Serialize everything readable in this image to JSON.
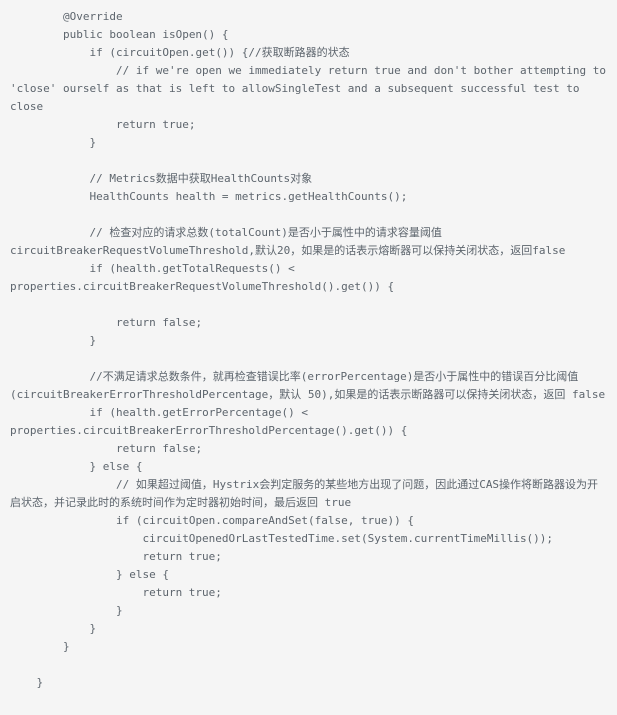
{
  "page": {
    "kind": "code-snippet",
    "language": "java",
    "background_color": "#f5f5f5",
    "text_color": "#5d656d"
  },
  "code": {
    "lines": [
      "        @Override",
      "        public boolean isOpen() {",
      "            if (circuitOpen.get()) {//获取断路器的状态",
      "                // if we're open we immediately return true and don't bother attempting to 'close' ourself as that is left to allowSingleTest and a subsequent successful test to close",
      "                return true;",
      "            }",
      "",
      "            // Metrics数据中获取HealthCounts对象",
      "            HealthCounts health = metrics.getHealthCounts();",
      "",
      "            // 检查对应的请求总数(totalCount)是否小于属性中的请求容量阈值circuitBreakerRequestVolumeThreshold,默认20，如果是的话表示熔断器可以保持关闭状态，返回false",
      "            if (health.getTotalRequests() < properties.circuitBreakerRequestVolumeThreshold().get()) {",
      "",
      "                return false;",
      "            }",
      "",
      "            //不满足请求总数条件，就再检查错误比率(errorPercentage)是否小于属性中的错误百分比阈值(circuitBreakerErrorThresholdPercentage，默认 50),如果是的话表示断路器可以保持关闭状态，返回 false",
      "            if (health.getErrorPercentage() < properties.circuitBreakerErrorThresholdPercentage().get()) {",
      "                return false;",
      "            } else {",
      "                // 如果超过阈值，Hystrix会判定服务的某些地方出现了问题，因此通过CAS操作将断路器设为开启状态，并记录此时的系统时间作为定时器初始时间，最后返回 true",
      "                if (circuitOpen.compareAndSet(false, true)) {",
      "                    circuitOpenedOrLastTestedTime.set(System.currentTimeMillis());",
      "                    return true;",
      "                } else {",
      "                    return true;",
      "                }",
      "            }",
      "        }",
      "",
      "    }"
    ]
  }
}
